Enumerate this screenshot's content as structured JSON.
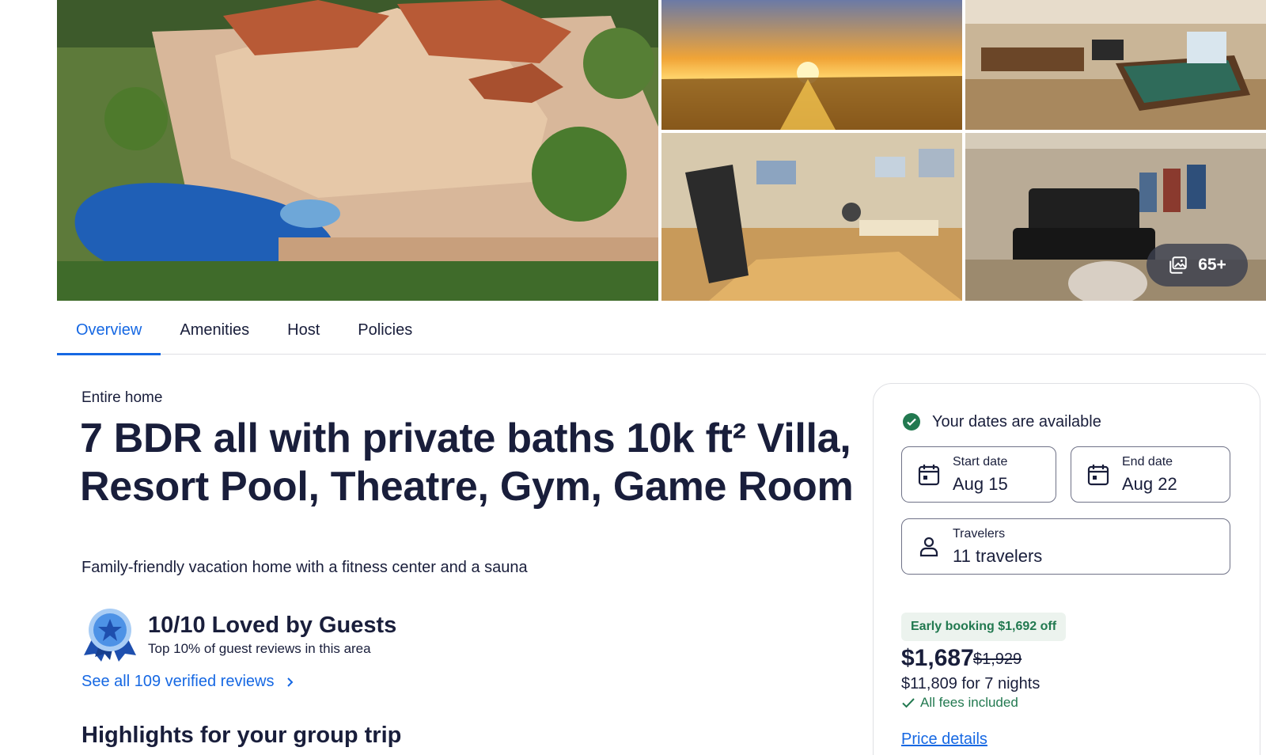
{
  "gallery": {
    "photo_count_label": "65+",
    "photos": [
      "villa-aerial",
      "sunset",
      "game-room",
      "gym",
      "home-theater"
    ]
  },
  "tabs": [
    {
      "label": "Overview",
      "active": true
    },
    {
      "label": "Amenities",
      "active": false
    },
    {
      "label": "Host",
      "active": false
    },
    {
      "label": "Policies",
      "active": false
    }
  ],
  "property": {
    "type": "Entire home",
    "title": "7 BDR all with private baths 10k ft² Villa, Resort Pool, Theatre, Gym, Game Room",
    "tagline": "Family-friendly vacation home with a fitness center and a sauna"
  },
  "rating": {
    "title": "10/10 Loved by Guests",
    "subtitle": "Top 10% of guest reviews in this area",
    "reviews_link": "See all 109 verified reviews"
  },
  "highlights_heading": "Highlights for your group trip",
  "booking": {
    "availability": "Your dates are available",
    "start": {
      "label": "Start date",
      "value": "Aug 15"
    },
    "end": {
      "label": "End date",
      "value": "Aug 22"
    },
    "travelers": {
      "label": "Travelers",
      "value": "11 travelers"
    },
    "deal_badge": "Early booking $1,692 off",
    "price": "$1,687",
    "original_price": "$1,929",
    "total": "$11,809 for 7 nights",
    "fees_note": "All fees included",
    "price_details_link": "Price details"
  },
  "colors": {
    "link_blue": "#1668e3",
    "text_dark": "#191e3b",
    "success_green": "#227950",
    "deal_bg": "#ecf3ee"
  }
}
